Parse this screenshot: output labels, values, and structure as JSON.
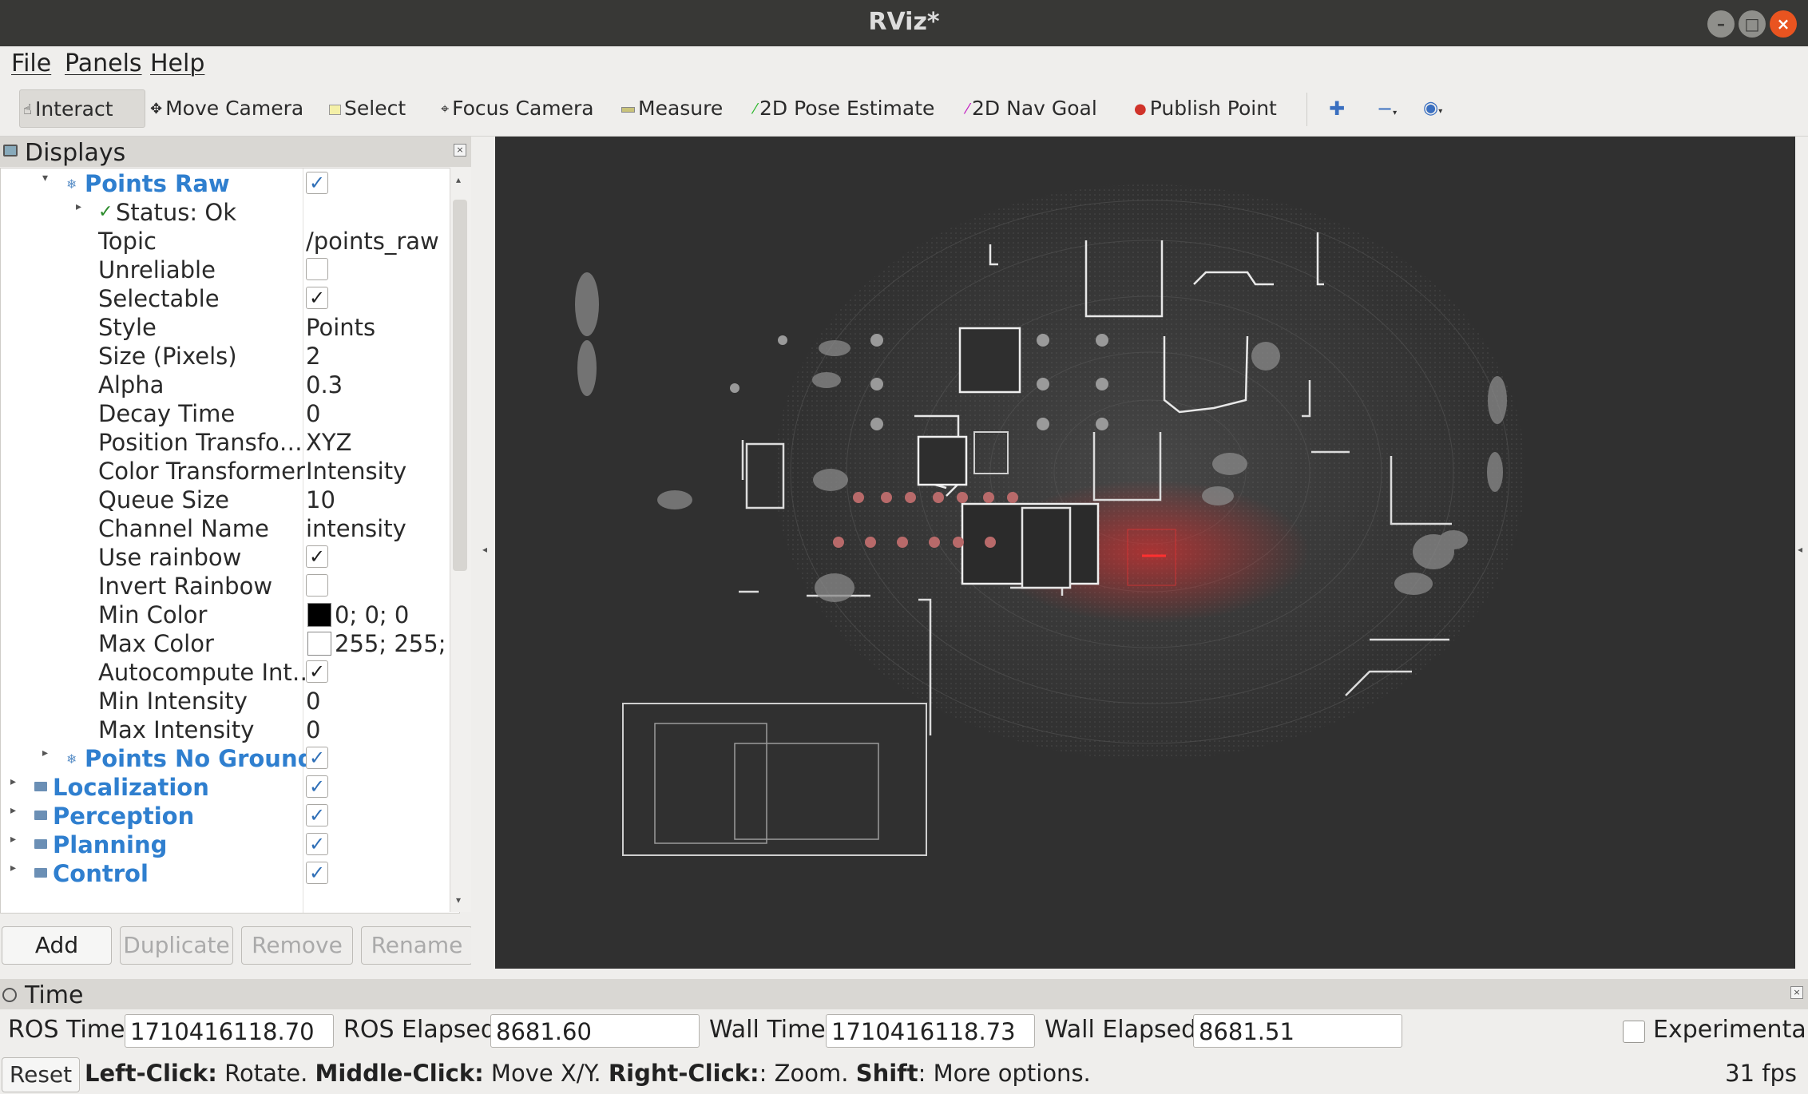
{
  "window": {
    "title": "RViz*"
  },
  "menu": [
    "File",
    "Panels",
    "Help"
  ],
  "toolbar": {
    "tools": [
      {
        "label": "Interact",
        "icon": "hand-icon",
        "active": true
      },
      {
        "label": "Move Camera",
        "icon": "move-camera-icon"
      },
      {
        "label": "Select",
        "icon": "select-icon"
      },
      {
        "label": "Focus Camera",
        "icon": "focus-camera-icon"
      },
      {
        "label": "Measure",
        "icon": "measure-icon"
      },
      {
        "label": "2D Pose Estimate",
        "icon": "pose-estimate-icon",
        "color": "#2eb82e"
      },
      {
        "label": "2D Nav Goal",
        "icon": "nav-goal-icon",
        "color": "#c21fc2"
      },
      {
        "label": "Publish Point",
        "icon": "publish-point-icon",
        "color": "#d0332a"
      }
    ],
    "extra_icons": [
      "plus-icon",
      "minus-icon",
      "eye-icon"
    ]
  },
  "displays": {
    "title": "Displays",
    "points_raw": {
      "name": "Points Raw",
      "enabled": true,
      "status": "Status: Ok",
      "properties": [
        {
          "label": "Topic",
          "value": "/points_raw"
        },
        {
          "label": "Unreliable",
          "checkbox": false
        },
        {
          "label": "Selectable",
          "checkbox": true
        },
        {
          "label": "Style",
          "value": "Points"
        },
        {
          "label": "Size (Pixels)",
          "value": "2"
        },
        {
          "label": "Alpha",
          "value": "0.3"
        },
        {
          "label": "Decay Time",
          "value": "0"
        },
        {
          "label": "Position Transfo…",
          "value": "XYZ"
        },
        {
          "label": "Color Transformer",
          "value": "Intensity"
        },
        {
          "label": "Queue Size",
          "value": "10"
        },
        {
          "label": "Channel Name",
          "value": "intensity"
        },
        {
          "label": "Use rainbow",
          "checkbox": true
        },
        {
          "label": "Invert Rainbow",
          "checkbox": false
        },
        {
          "label": "Min Color",
          "value": "0; 0; 0",
          "swatch": "#000000"
        },
        {
          "label": "Max Color",
          "value": "255; 255;",
          "swatch": "#ffffff"
        },
        {
          "label": "Autocompute Int…",
          "checkbox": true
        },
        {
          "label": "Min Intensity",
          "value": "0"
        },
        {
          "label": "Max Intensity",
          "value": "0"
        }
      ]
    },
    "points_no_ground": {
      "name": "Points No Ground",
      "enabled": true
    },
    "groups": [
      {
        "name": "Localization",
        "enabled": true
      },
      {
        "name": "Perception",
        "enabled": true
      },
      {
        "name": "Planning",
        "enabled": true
      },
      {
        "name": "Control",
        "enabled": true
      }
    ],
    "buttons": {
      "add": "Add",
      "duplicate": "Duplicate",
      "remove": "Remove",
      "rename": "Rename"
    }
  },
  "time": {
    "title": "Time",
    "ros_time_label": "ROS Time:",
    "ros_time": "1710416118.70",
    "ros_elapsed_label": "ROS Elapsed:",
    "ros_elapsed": "8681.60",
    "wall_time_label": "Wall Time:",
    "wall_time": "1710416118.73",
    "wall_elapsed_label": "Wall Elapsed:",
    "wall_elapsed": "8681.51",
    "experimental_label": "Experimental",
    "experimental": false
  },
  "status": {
    "reset": "Reset",
    "hint": [
      {
        "b": "Left-Click:",
        "t": " Rotate. "
      },
      {
        "b": "Middle-Click:",
        "t": " Move X/Y. "
      },
      {
        "b": "Right-Click:",
        "t": ": Zoom. "
      },
      {
        "b": "Shift",
        "t": ": More options."
      }
    ],
    "fps": "31 fps"
  },
  "colors": {
    "accent": "#2f7fcf",
    "close_button": "#e95420",
    "viewport_bg": "#303030",
    "point_cloud_highlight": "#ff2a2a"
  }
}
